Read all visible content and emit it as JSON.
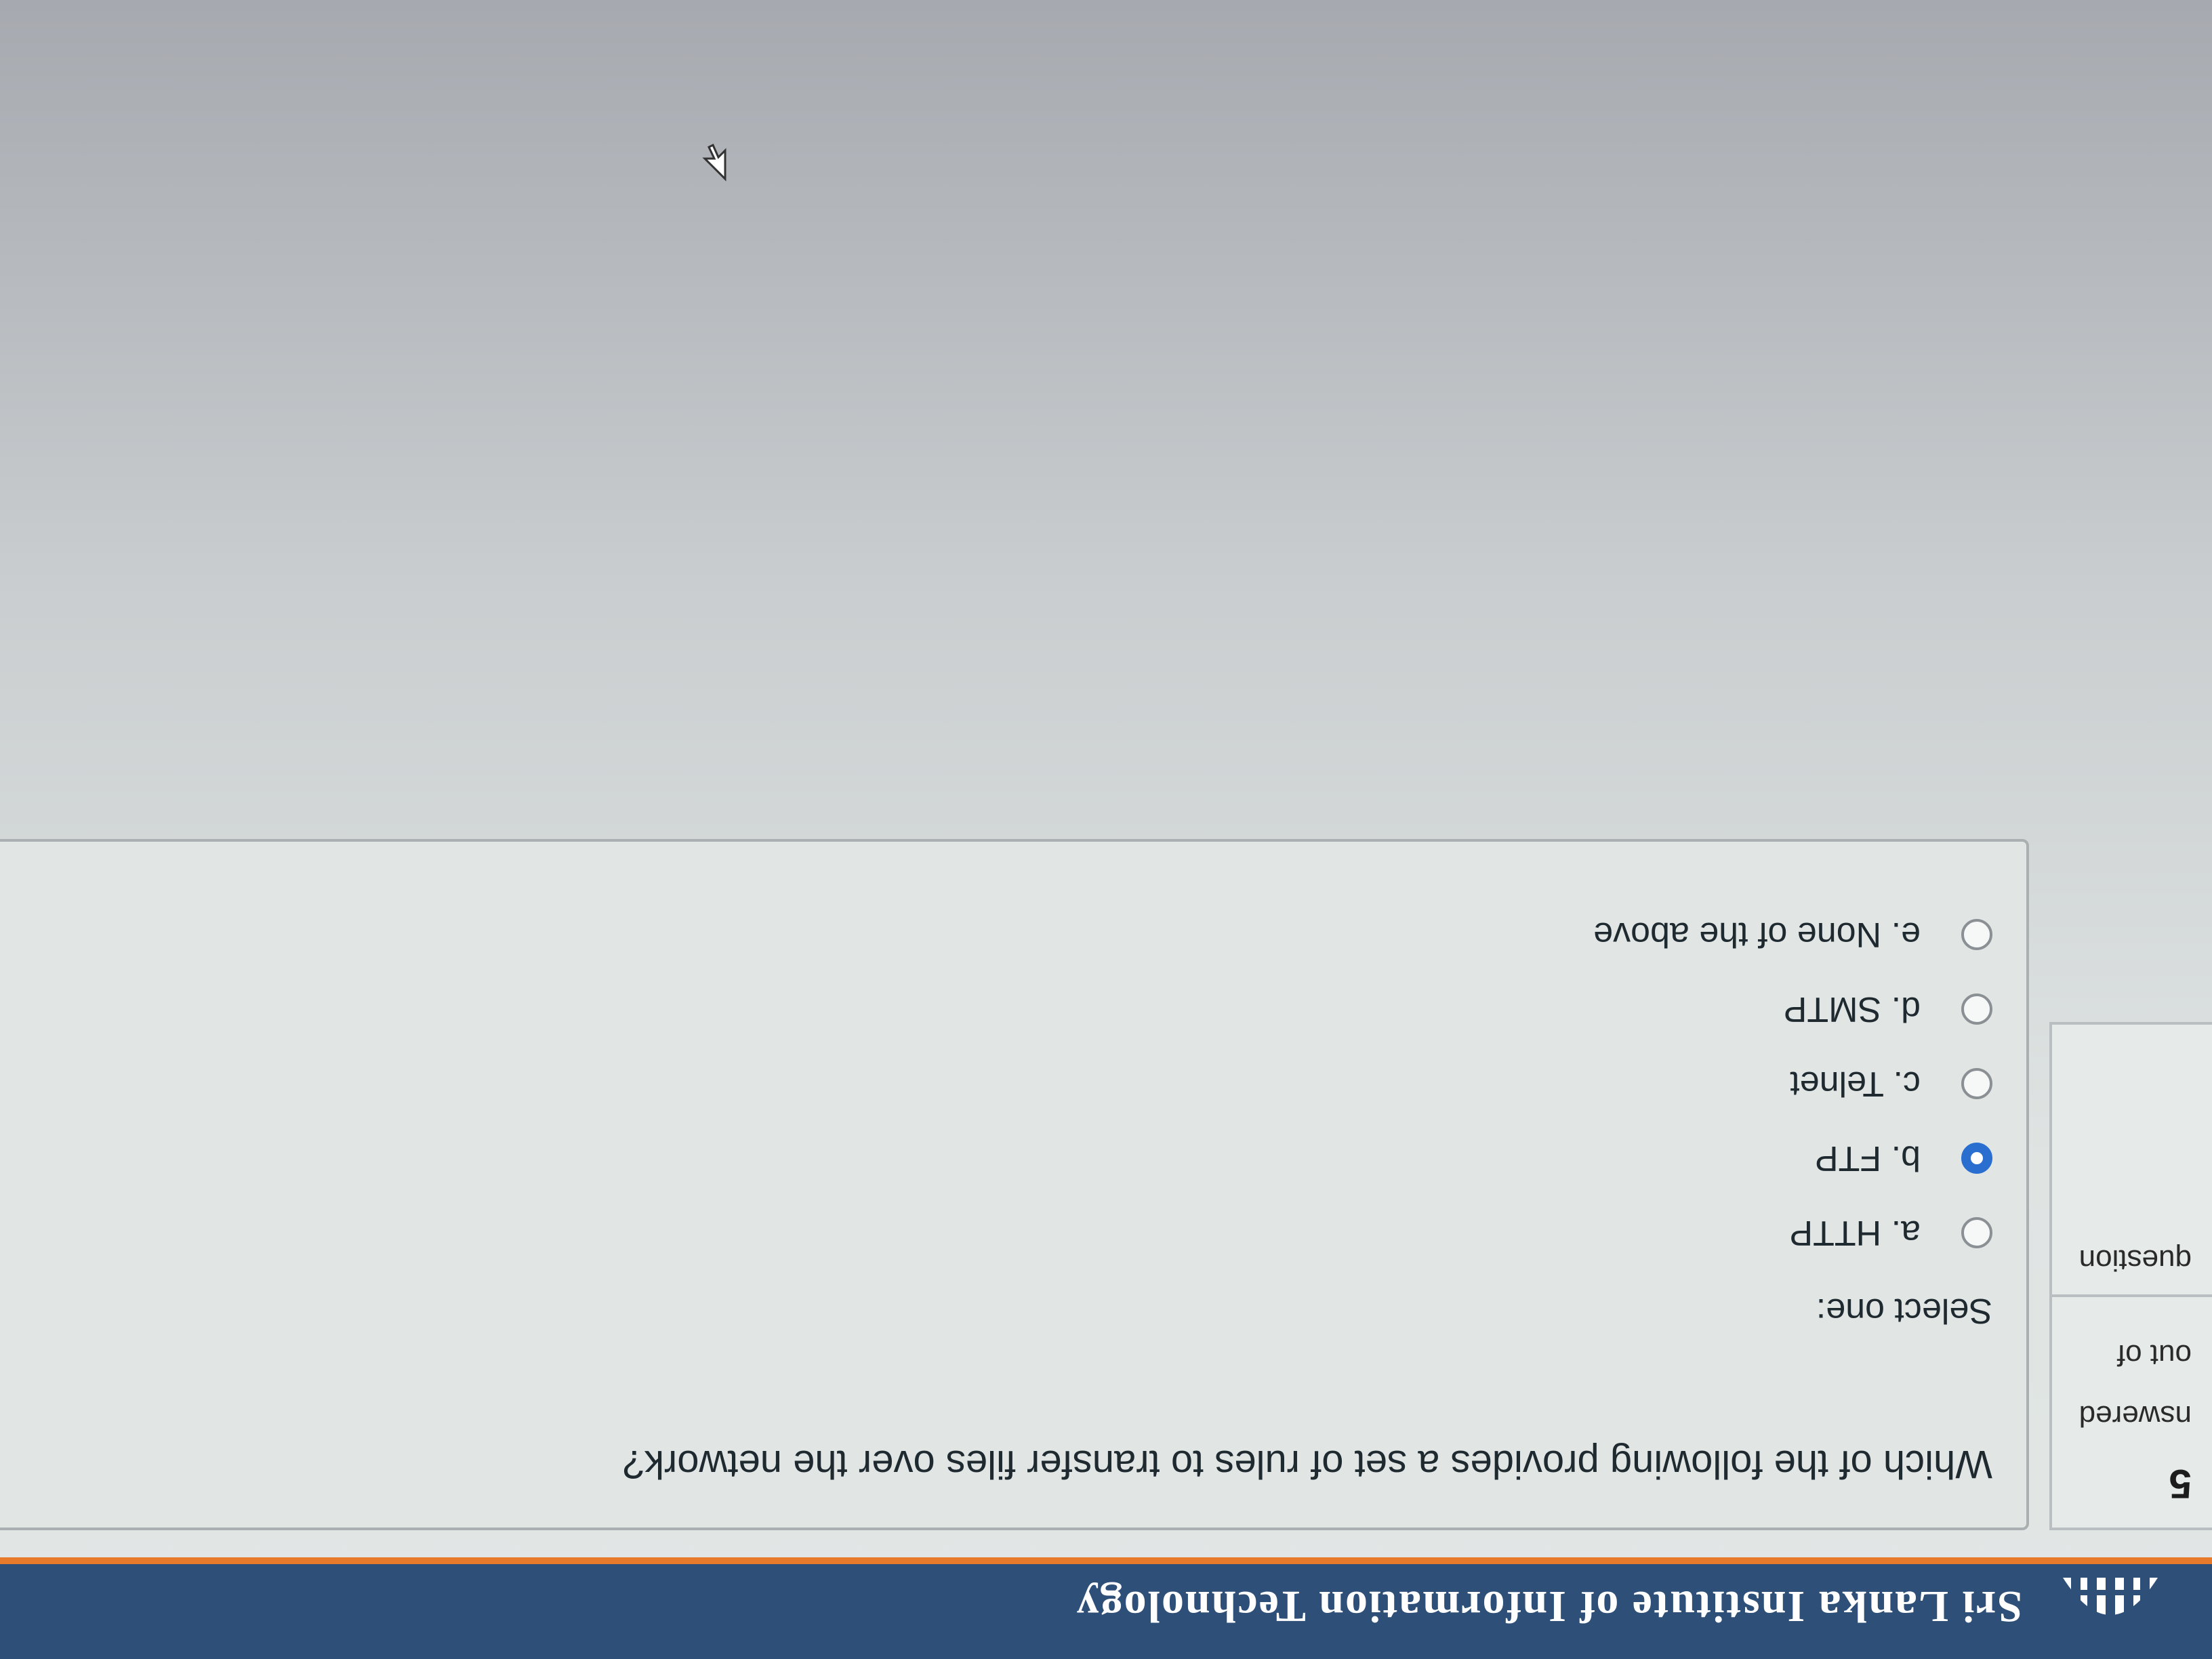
{
  "header": {
    "title": "Sri Lanka Institute of Information Technology"
  },
  "question_info": {
    "number": "5",
    "status": "nswered",
    "marks": "out of",
    "flag": "question"
  },
  "question": {
    "text": "Which of the following provides a set of rules to transfer files over the network?",
    "select_label": "Select one:",
    "options": [
      {
        "label": "a. HTTP",
        "selected": false
      },
      {
        "label": "b. FTP",
        "selected": true
      },
      {
        "label": "c. Telnet",
        "selected": false
      },
      {
        "label": "d. SMTP",
        "selected": false
      },
      {
        "label": "e. None of the above",
        "selected": false
      }
    ]
  },
  "colors": {
    "header_bg": "#2d4f78",
    "header_accent": "#e87a2c",
    "radio_selected": "#2a6fd0"
  },
  "icons": {
    "logo": "institute-logo-icon",
    "cursor": "mouse-pointer-icon"
  }
}
